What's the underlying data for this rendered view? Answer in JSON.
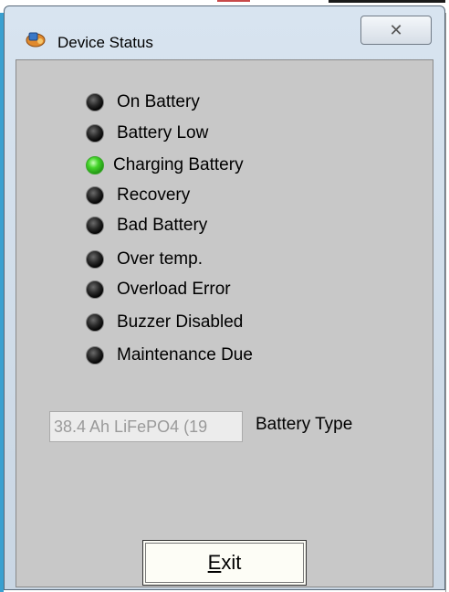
{
  "window": {
    "title": "Device Status",
    "icon": "device-app-icon",
    "close_glyph": "✕"
  },
  "status_indicators": [
    {
      "label": "On Battery",
      "state": "off"
    },
    {
      "label": "Battery Low",
      "state": "off"
    },
    {
      "label": "Charging Battery",
      "state": "on"
    },
    {
      "label": "Recovery",
      "state": "off"
    },
    {
      "label": "Bad Battery",
      "state": "off"
    },
    {
      "label": "Over temp.",
      "state": "off"
    },
    {
      "label": "Overload Error",
      "state": "off"
    },
    {
      "label": "Buzzer Disabled",
      "state": "off"
    },
    {
      "label": "Maintenance Due",
      "state": "off"
    }
  ],
  "battery": {
    "value": "38.4 Ah LiFePO4 (19",
    "label": "Battery Type"
  },
  "exit_button": {
    "mnemonic": "E",
    "rest": "xit"
  },
  "colors": {
    "led_on": "#44d42a",
    "led_off": "#1a1a1a",
    "panel_bg": "#c8c8c8"
  }
}
